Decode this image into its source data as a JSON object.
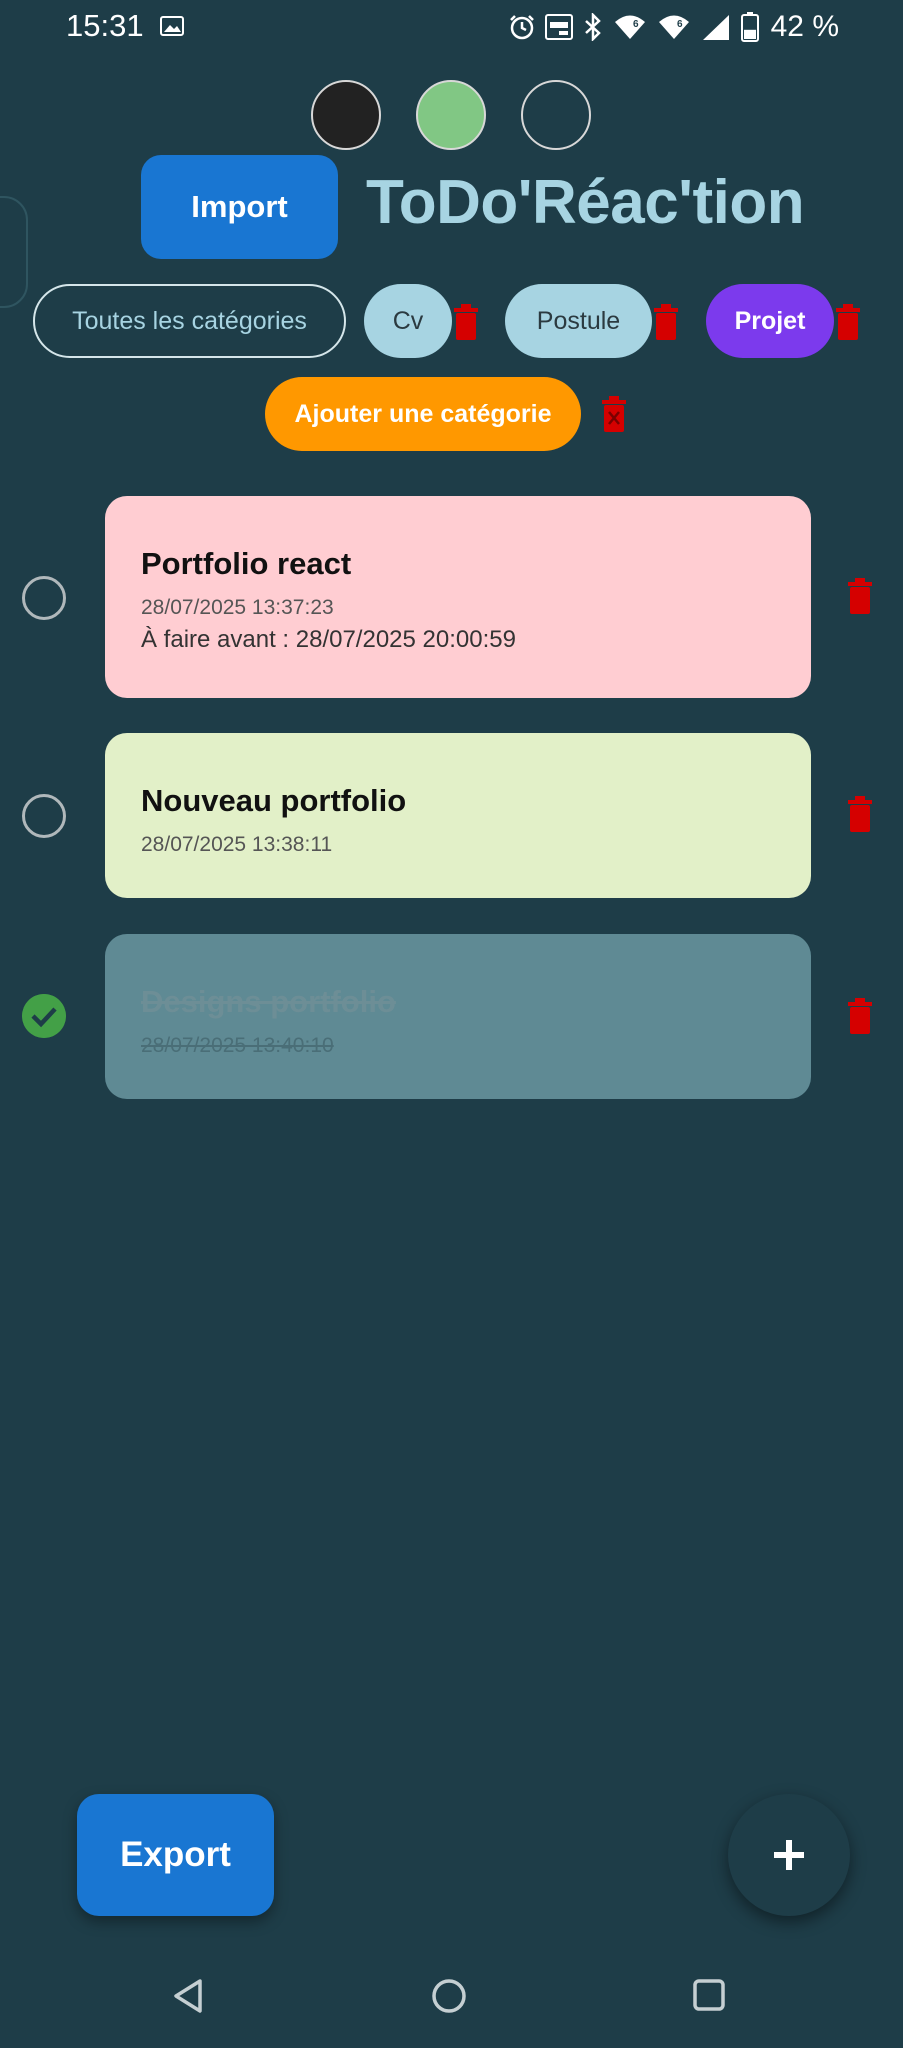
{
  "status_bar": {
    "time": "15:31",
    "battery_percent": "42 %",
    "battery_level": 0.42,
    "icons": [
      "gallery-icon",
      "alarm-icon",
      "auto-hz-icon",
      "bluetooth-icon",
      "wifi-6-icon",
      "wifi-6-icon",
      "signal-icon",
      "battery-icon"
    ]
  },
  "theme_picker": {
    "options": [
      {
        "name": "dark",
        "color": "#222222"
      },
      {
        "name": "green",
        "color": "#81c784"
      },
      {
        "name": "teal",
        "color": "#1e3d48"
      }
    ]
  },
  "header": {
    "import_label": "Import",
    "title": "ToDo'Réac'tion"
  },
  "categories": {
    "all_label": "Toutes les catégories",
    "items": [
      {
        "label": "Cv",
        "color": "#a7d4e2"
      },
      {
        "label": "Postule",
        "color": "#a7d4e2"
      },
      {
        "label": "Projet",
        "color": "#7c3aed"
      }
    ],
    "add_label": "Ajouter une catégorie"
  },
  "tasks": [
    {
      "title": "Portfolio react",
      "created": "28/07/2025 13:37:23",
      "due": "À faire avant : 28/07/2025 20:00:59",
      "done": false,
      "color": "#ffcdd2"
    },
    {
      "title": "Nouveau portfolio",
      "created": "28/07/2025 13:38:11",
      "done": false,
      "color": "#e2f0c8"
    },
    {
      "title": "Designs portfolio",
      "created": "28/07/2025 13:40:10",
      "done": true,
      "color": "#5f8a94"
    }
  ],
  "footer": {
    "export_label": "Export",
    "add_task_icon": "plus-icon"
  },
  "colors": {
    "background": "#1e3d48",
    "primary": "#1976d2",
    "accent": "#ff9800",
    "delete": "#d50000",
    "done": "#43a047"
  }
}
